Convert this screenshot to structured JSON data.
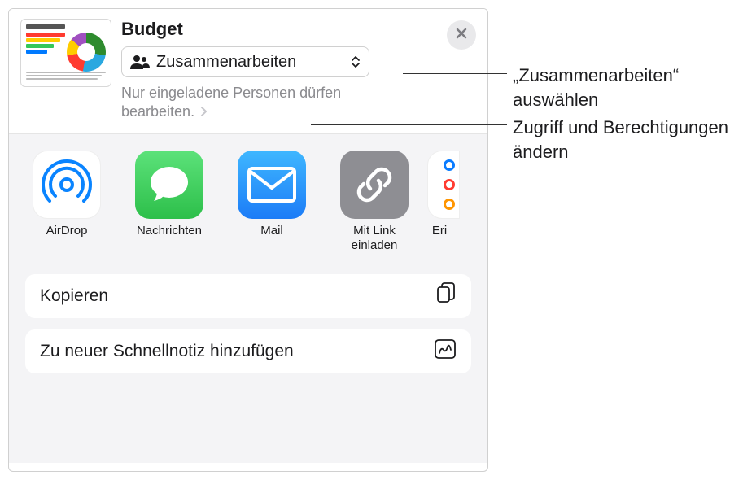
{
  "header": {
    "title": "Budget",
    "dropdown_label": "Zusammenarbeiten",
    "permission_text": "Nur eingeladene Personen dürfen bearbeiten."
  },
  "share_items": [
    {
      "label": "AirDrop",
      "icon": "airdrop"
    },
    {
      "label": "Nachrichten",
      "icon": "messages"
    },
    {
      "label": "Mail",
      "icon": "mail"
    },
    {
      "label": "Mit Link einladen",
      "icon": "link"
    },
    {
      "label": "Eri",
      "icon": "reminders"
    }
  ],
  "actions": {
    "copy": "Kopieren",
    "quicknote": "Zu neuer Schnellnotiz hinzufügen"
  },
  "callouts": {
    "c1": "„Zusammenarbeiten“ auswählen",
    "c2": "Zugriff und Berechtigungen ändern"
  }
}
